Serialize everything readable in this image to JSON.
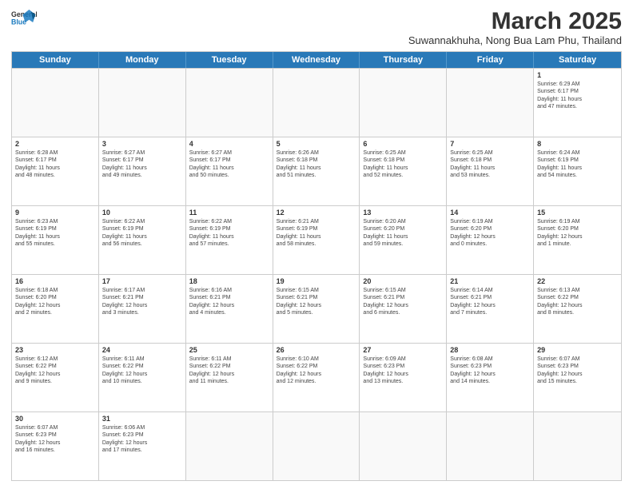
{
  "header": {
    "logo_line1": "General",
    "logo_line2": "Blue",
    "month_title": "March 2025",
    "location": "Suwannakhuha, Nong Bua Lam Phu, Thailand"
  },
  "days_of_week": [
    "Sunday",
    "Monday",
    "Tuesday",
    "Wednesday",
    "Thursday",
    "Friday",
    "Saturday"
  ],
  "weeks": [
    [
      {
        "day": "",
        "info": ""
      },
      {
        "day": "",
        "info": ""
      },
      {
        "day": "",
        "info": ""
      },
      {
        "day": "",
        "info": ""
      },
      {
        "day": "",
        "info": ""
      },
      {
        "day": "",
        "info": ""
      },
      {
        "day": "1",
        "info": "Sunrise: 6:29 AM\nSunset: 6:17 PM\nDaylight: 11 hours\nand 47 minutes."
      }
    ],
    [
      {
        "day": "2",
        "info": "Sunrise: 6:28 AM\nSunset: 6:17 PM\nDaylight: 11 hours\nand 48 minutes."
      },
      {
        "day": "3",
        "info": "Sunrise: 6:27 AM\nSunset: 6:17 PM\nDaylight: 11 hours\nand 49 minutes."
      },
      {
        "day": "4",
        "info": "Sunrise: 6:27 AM\nSunset: 6:17 PM\nDaylight: 11 hours\nand 50 minutes."
      },
      {
        "day": "5",
        "info": "Sunrise: 6:26 AM\nSunset: 6:18 PM\nDaylight: 11 hours\nand 51 minutes."
      },
      {
        "day": "6",
        "info": "Sunrise: 6:25 AM\nSunset: 6:18 PM\nDaylight: 11 hours\nand 52 minutes."
      },
      {
        "day": "7",
        "info": "Sunrise: 6:25 AM\nSunset: 6:18 PM\nDaylight: 11 hours\nand 53 minutes."
      },
      {
        "day": "8",
        "info": "Sunrise: 6:24 AM\nSunset: 6:19 PM\nDaylight: 11 hours\nand 54 minutes."
      }
    ],
    [
      {
        "day": "9",
        "info": "Sunrise: 6:23 AM\nSunset: 6:19 PM\nDaylight: 11 hours\nand 55 minutes."
      },
      {
        "day": "10",
        "info": "Sunrise: 6:22 AM\nSunset: 6:19 PM\nDaylight: 11 hours\nand 56 minutes."
      },
      {
        "day": "11",
        "info": "Sunrise: 6:22 AM\nSunset: 6:19 PM\nDaylight: 11 hours\nand 57 minutes."
      },
      {
        "day": "12",
        "info": "Sunrise: 6:21 AM\nSunset: 6:19 PM\nDaylight: 11 hours\nand 58 minutes."
      },
      {
        "day": "13",
        "info": "Sunrise: 6:20 AM\nSunset: 6:20 PM\nDaylight: 11 hours\nand 59 minutes."
      },
      {
        "day": "14",
        "info": "Sunrise: 6:19 AM\nSunset: 6:20 PM\nDaylight: 12 hours\nand 0 minutes."
      },
      {
        "day": "15",
        "info": "Sunrise: 6:19 AM\nSunset: 6:20 PM\nDaylight: 12 hours\nand 1 minute."
      }
    ],
    [
      {
        "day": "16",
        "info": "Sunrise: 6:18 AM\nSunset: 6:20 PM\nDaylight: 12 hours\nand 2 minutes."
      },
      {
        "day": "17",
        "info": "Sunrise: 6:17 AM\nSunset: 6:21 PM\nDaylight: 12 hours\nand 3 minutes."
      },
      {
        "day": "18",
        "info": "Sunrise: 6:16 AM\nSunset: 6:21 PM\nDaylight: 12 hours\nand 4 minutes."
      },
      {
        "day": "19",
        "info": "Sunrise: 6:15 AM\nSunset: 6:21 PM\nDaylight: 12 hours\nand 5 minutes."
      },
      {
        "day": "20",
        "info": "Sunrise: 6:15 AM\nSunset: 6:21 PM\nDaylight: 12 hours\nand 6 minutes."
      },
      {
        "day": "21",
        "info": "Sunrise: 6:14 AM\nSunset: 6:21 PM\nDaylight: 12 hours\nand 7 minutes."
      },
      {
        "day": "22",
        "info": "Sunrise: 6:13 AM\nSunset: 6:22 PM\nDaylight: 12 hours\nand 8 minutes."
      }
    ],
    [
      {
        "day": "23",
        "info": "Sunrise: 6:12 AM\nSunset: 6:22 PM\nDaylight: 12 hours\nand 9 minutes."
      },
      {
        "day": "24",
        "info": "Sunrise: 6:11 AM\nSunset: 6:22 PM\nDaylight: 12 hours\nand 10 minutes."
      },
      {
        "day": "25",
        "info": "Sunrise: 6:11 AM\nSunset: 6:22 PM\nDaylight: 12 hours\nand 11 minutes."
      },
      {
        "day": "26",
        "info": "Sunrise: 6:10 AM\nSunset: 6:22 PM\nDaylight: 12 hours\nand 12 minutes."
      },
      {
        "day": "27",
        "info": "Sunrise: 6:09 AM\nSunset: 6:23 PM\nDaylight: 12 hours\nand 13 minutes."
      },
      {
        "day": "28",
        "info": "Sunrise: 6:08 AM\nSunset: 6:23 PM\nDaylight: 12 hours\nand 14 minutes."
      },
      {
        "day": "29",
        "info": "Sunrise: 6:07 AM\nSunset: 6:23 PM\nDaylight: 12 hours\nand 15 minutes."
      }
    ],
    [
      {
        "day": "30",
        "info": "Sunrise: 6:07 AM\nSunset: 6:23 PM\nDaylight: 12 hours\nand 16 minutes."
      },
      {
        "day": "31",
        "info": "Sunrise: 6:06 AM\nSunset: 6:23 PM\nDaylight: 12 hours\nand 17 minutes."
      },
      {
        "day": "",
        "info": ""
      },
      {
        "day": "",
        "info": ""
      },
      {
        "day": "",
        "info": ""
      },
      {
        "day": "",
        "info": ""
      },
      {
        "day": "",
        "info": ""
      }
    ]
  ]
}
